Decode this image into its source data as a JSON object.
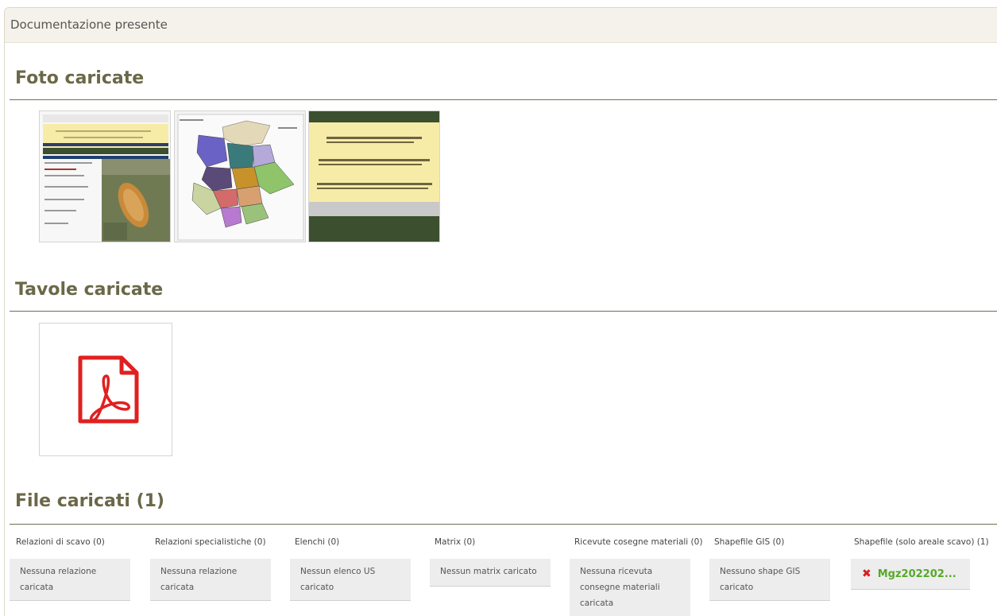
{
  "panel": {
    "title": "Documentazione presente"
  },
  "sections": {
    "photos": {
      "title": "Foto caricate"
    },
    "tables": {
      "title": "Tavole caricate"
    },
    "files": {
      "title": "File caricati (1)"
    }
  },
  "photos": [
    {
      "icon": "photo-thumbnail-map-screenshot"
    },
    {
      "icon": "photo-thumbnail-regional-map"
    },
    {
      "icon": "photo-thumbnail-text-slide"
    }
  ],
  "tables": [
    {
      "icon": "pdf-icon"
    }
  ],
  "file_columns": [
    {
      "title": "Relazioni di scavo (0)",
      "empty": "Nessuna relazione caricata"
    },
    {
      "title": "Relazioni specialistiche (0)",
      "empty": "Nessuna relazione caricata"
    },
    {
      "title": "Elenchi (0)",
      "empty": "Nessun elenco US caricato"
    },
    {
      "title": "Matrix (0)",
      "empty": "Nessun matrix caricato"
    },
    {
      "title": "Ricevute cosegne materiali (0)",
      "empty": "Nessuna ricevuta consegne materiali caricata"
    },
    {
      "title": "Shapefile GIS (0)",
      "empty": "Nessuno shape GIS caricato"
    },
    {
      "title": "Shapefile (solo areale scavo) (1)",
      "file": "Mgz202202...",
      "remove_icon": "remove-x-icon"
    }
  ],
  "colors": {
    "accent_title": "#6b6848",
    "file_link": "#57a82a",
    "remove": "#d42020",
    "pdf": "#e02020"
  }
}
